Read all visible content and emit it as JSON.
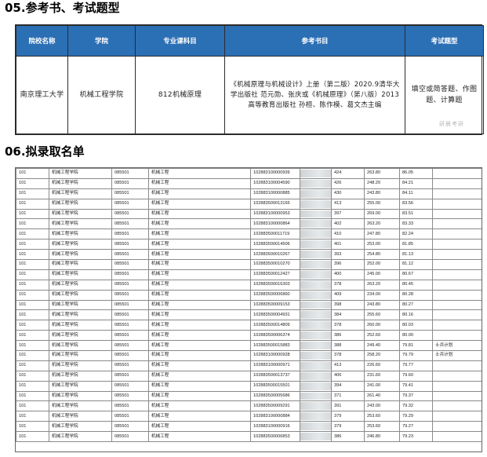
{
  "sections": {
    "reference_title": "05.参考书、考试题型",
    "admission_title": "06.拟录取名单"
  },
  "reference_table": {
    "headers": [
      "院校名称",
      "学院",
      "专业课科目",
      "参考书目",
      "考试题型"
    ],
    "row": {
      "school": "南京理工大学",
      "college": "机械工程学院",
      "subject": "812机械原理",
      "books": "《机械原理与机械设计》上册（第二版）2020.9清华大学出版社 范元勋、张庆或《机械原理》（第八版）2013 高等教育出版社 孙桓、陈作模、葛文杰主编",
      "question_types": "填空或简答题、作图题、计算题",
      "watermark": "研晨考研"
    }
  },
  "admission_list": {
    "rows": [
      [
        "101",
        "机械工程学院",
        "085501",
        "机械工程",
        "102883100000939",
        "",
        "424",
        "263.80",
        "86.05",
        ""
      ],
      [
        "101",
        "机械工程学院",
        "085501",
        "机械工程",
        "102883100004590",
        "",
        "426",
        "248.20",
        "84.21",
        ""
      ],
      [
        "101",
        "机械工程学院",
        "085501",
        "机械工程",
        "102883100000885",
        "",
        "430",
        "243.80",
        "84.11",
        ""
      ],
      [
        "101",
        "机械工程学院",
        "085501",
        "机械工程",
        "102883500013165",
        "",
        "413",
        "255.00",
        "83.56",
        ""
      ],
      [
        "101",
        "机械工程学院",
        "085501",
        "机械工程",
        "102883100000953",
        "",
        "397",
        "269.00",
        "83.51",
        ""
      ],
      [
        "101",
        "机械工程学院",
        "085501",
        "机械工程",
        "102883100000864",
        "",
        "402",
        "263.20",
        "83.33",
        ""
      ],
      [
        "101",
        "机械工程学院",
        "085501",
        "机械工程",
        "102883500011719",
        "",
        "410",
        "247.80",
        "82.24",
        ""
      ],
      [
        "101",
        "机械工程学院",
        "085501",
        "机械工程",
        "102883500014506",
        "",
        "401",
        "253.00",
        "81.85",
        ""
      ],
      [
        "101",
        "机械工程学院",
        "085501",
        "机械工程",
        "102883500010267",
        "",
        "393",
        "254.80",
        "81.13",
        ""
      ],
      [
        "101",
        "机械工程学院",
        "085501",
        "机械工程",
        "102883500010270",
        "",
        "396",
        "252.00",
        "81.12",
        ""
      ],
      [
        "101",
        "机械工程学院",
        "085501",
        "机械工程",
        "102883500012427",
        "",
        "400",
        "245.00",
        "80.67",
        ""
      ],
      [
        "101",
        "机械工程学院",
        "085501",
        "机械工程",
        "102883500016303",
        "",
        "378",
        "263.20",
        "80.45",
        ""
      ],
      [
        "101",
        "机械工程学院",
        "085501",
        "机械工程",
        "102883500006860",
        "",
        "409",
        "234.00",
        "80.28",
        ""
      ],
      [
        "101",
        "机械工程学院",
        "085501",
        "机械工程",
        "102883500009153",
        "",
        "398",
        "243.80",
        "80.27",
        ""
      ],
      [
        "101",
        "机械工程学院",
        "085501",
        "机械工程",
        "102883500004931",
        "",
        "384",
        "255.60",
        "80.16",
        ""
      ],
      [
        "101",
        "机械工程学院",
        "085501",
        "机械工程",
        "102883500014809",
        "",
        "378",
        "260.00",
        "80.03",
        ""
      ],
      [
        "101",
        "机械工程学院",
        "085501",
        "机械工程",
        "102883500006374",
        "",
        "386",
        "252.60",
        "80.00",
        ""
      ],
      [
        "101",
        "机械工程学院",
        "085501",
        "机械工程",
        "102883500015883",
        "",
        "388",
        "249.40",
        "79.81",
        "士兵计划"
      ],
      [
        "101",
        "机械工程学院",
        "085501",
        "机械工程",
        "102883100000928",
        "",
        "378",
        "258.20",
        "79.79",
        "士兵计划"
      ],
      [
        "101",
        "机械工程学院",
        "085501",
        "机械工程",
        "102883100000971",
        "",
        "413",
        "226.60",
        "79.77",
        ""
      ],
      [
        "101",
        "机械工程学院",
        "085501",
        "机械工程",
        "102883500013737",
        "",
        "406",
        "231.60",
        "79.60",
        ""
      ],
      [
        "101",
        "机械工程学院",
        "085501",
        "机械工程",
        "102883500015501",
        "",
        "394",
        "241.00",
        "79.41",
        ""
      ],
      [
        "101",
        "机械工程学院",
        "085501",
        "机械工程",
        "102883500005686",
        "",
        "371",
        "261.40",
        "79.37",
        ""
      ],
      [
        "101",
        "机械工程学院",
        "085501",
        "机械工程",
        "102883500009291",
        "",
        "391",
        "243.00",
        "79.32",
        ""
      ],
      [
        "101",
        "机械工程学院",
        "085501",
        "机械工程",
        "102883100000884",
        "",
        "379",
        "253.60",
        "79.29",
        ""
      ],
      [
        "101",
        "机械工程学院",
        "085501",
        "机械工程",
        "102883100000916",
        "",
        "379",
        "253.60",
        "79.27",
        ""
      ],
      [
        "101",
        "机械工程学院",
        "085501",
        "机械工程",
        "102883500006853",
        "",
        "386",
        "246.80",
        "79.23",
        ""
      ]
    ]
  }
}
